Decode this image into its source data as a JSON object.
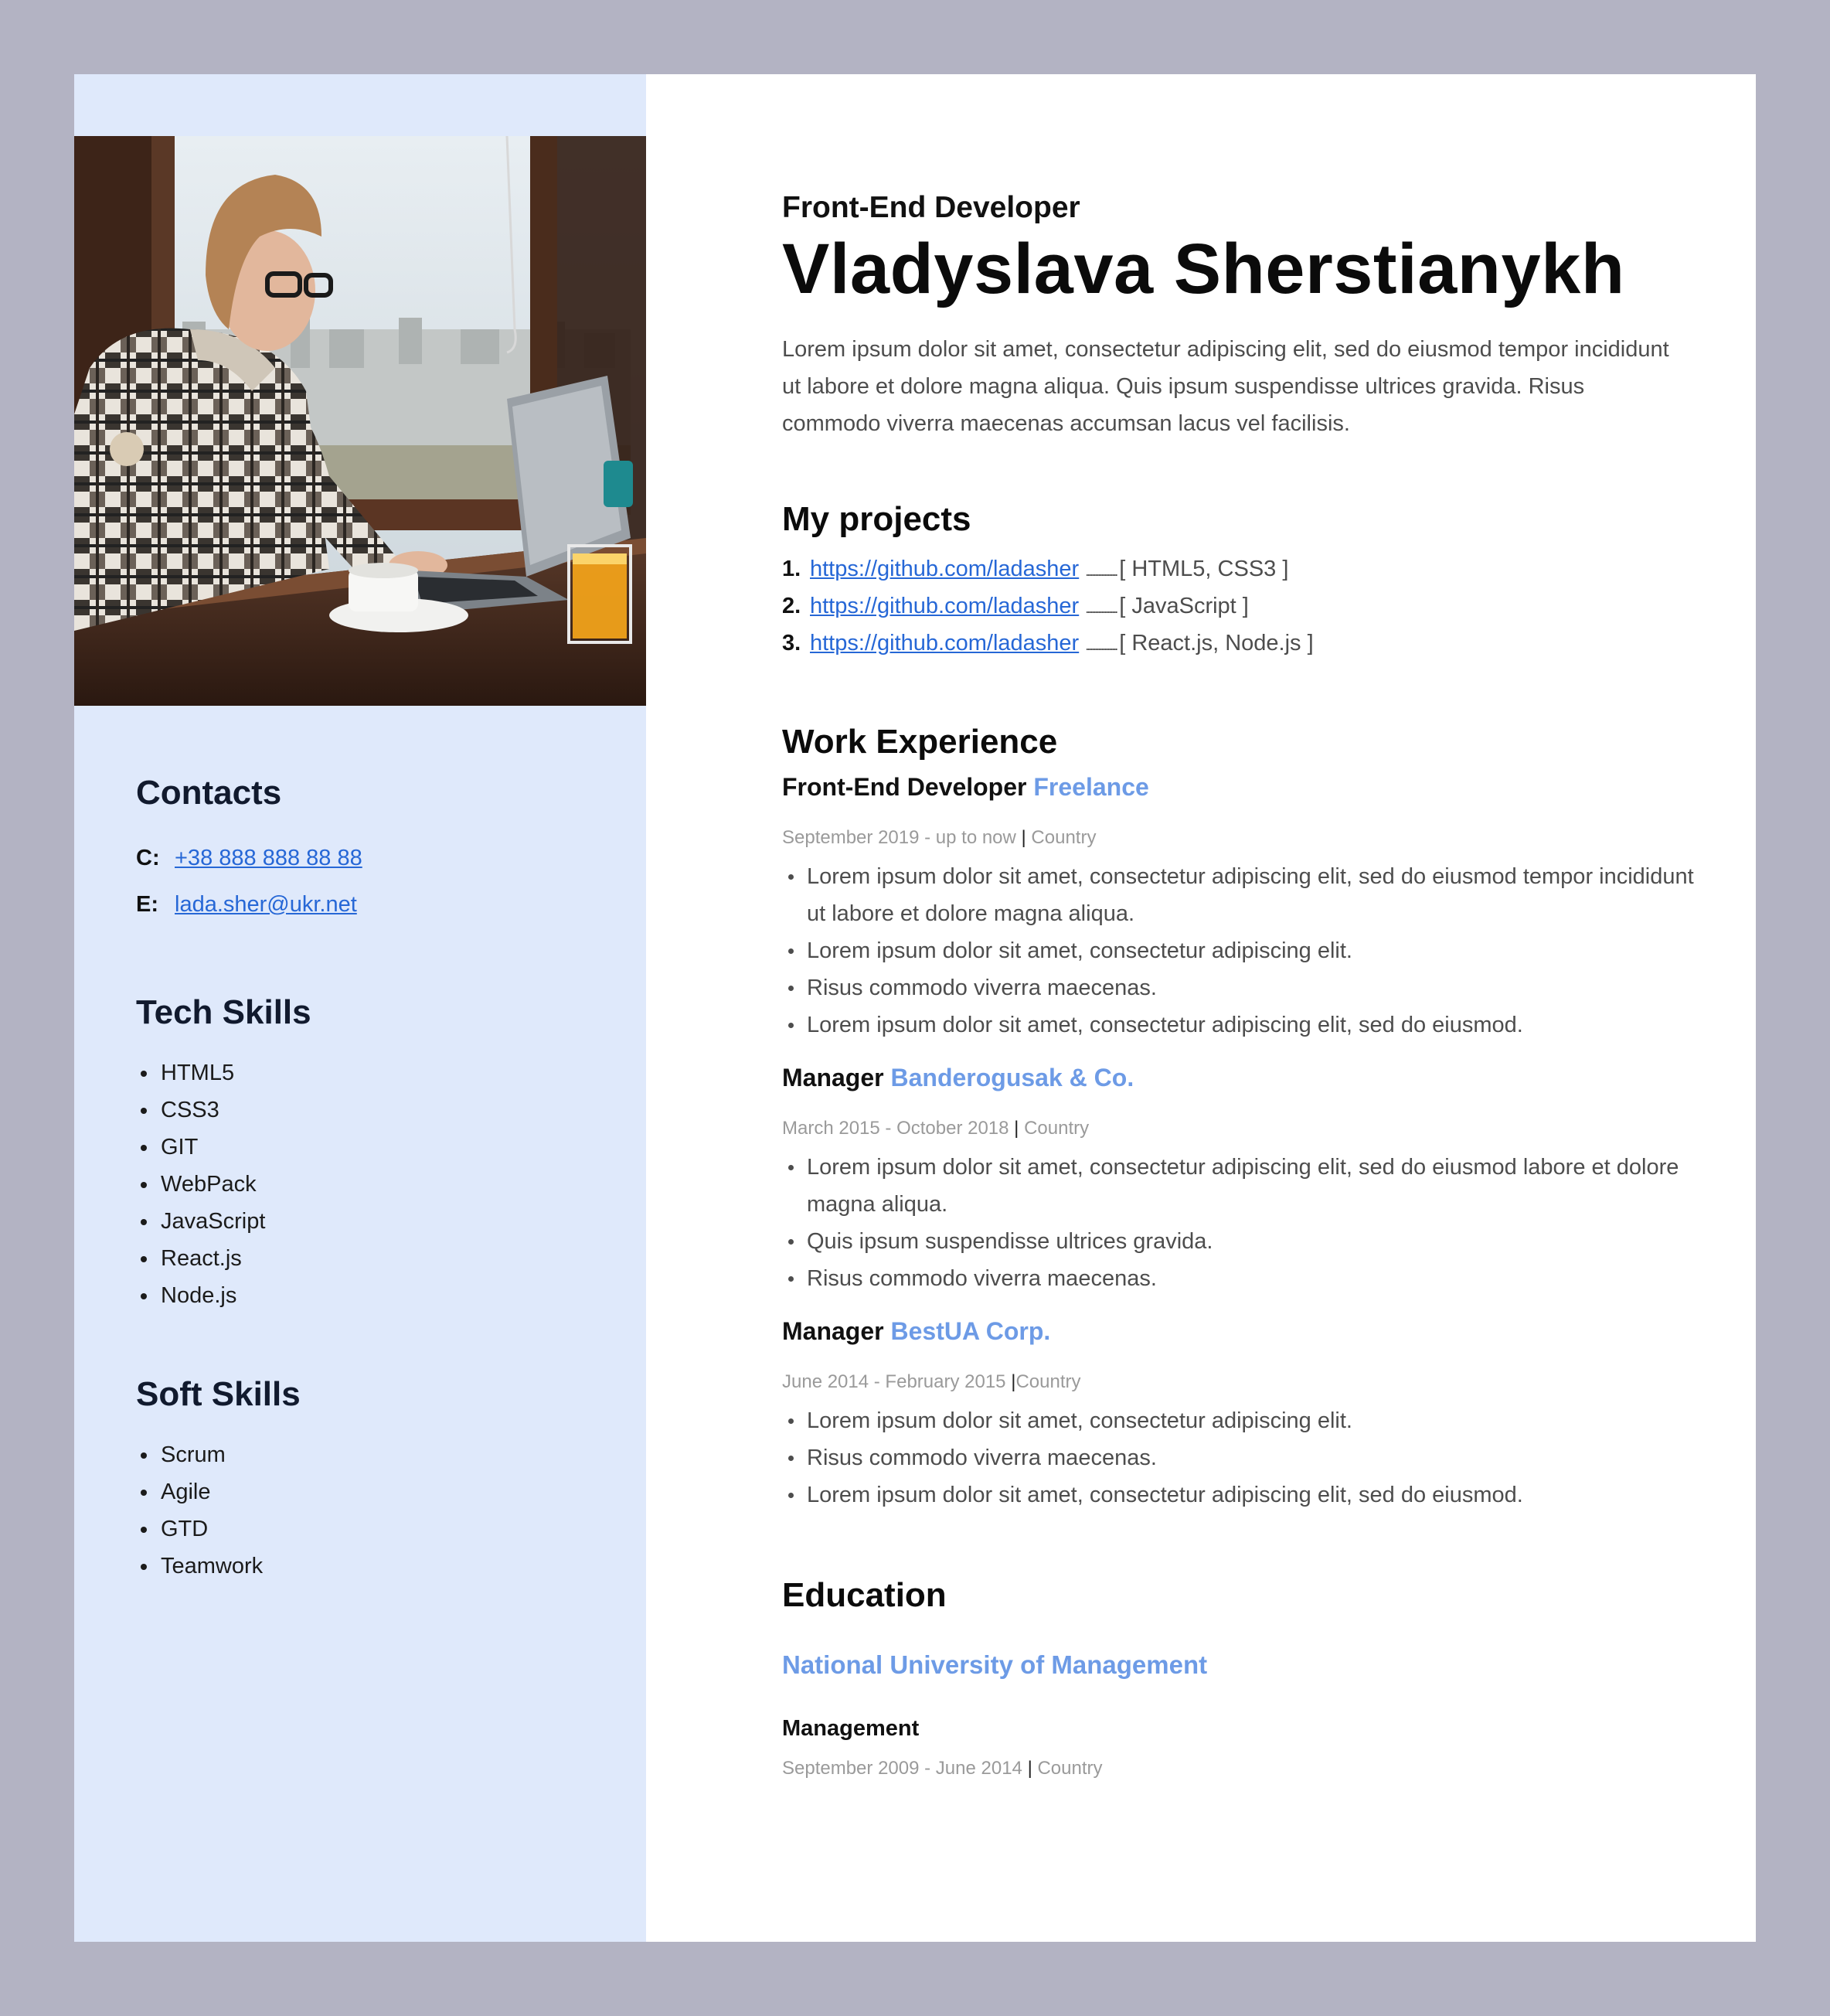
{
  "sidebar": {
    "photo_alt": "Woman in checkered shirt working on a laptop by a window",
    "contacts": {
      "heading": "Contacts",
      "phone_key": "C:",
      "phone": "+38 888 888 88 88",
      "email_key": "E:",
      "email": "lada.sher@ukr.net"
    },
    "tech_skills": {
      "heading": "Tech Skills",
      "items": [
        "HTML5",
        "CSS3",
        "GIT",
        "WebPack",
        "JavaScript",
        "React.js",
        "Node.js"
      ]
    },
    "soft_skills": {
      "heading": "Soft Skills",
      "items": [
        "Scrum",
        "Agile",
        "GTD",
        "Teamwork"
      ]
    }
  },
  "header": {
    "role": "Front-End Developer",
    "name": "Vladyslava Sherstianykh",
    "intro": "Lorem ipsum dolor sit amet, consectetur adipiscing elit, sed do eiusmod tempor incididunt ut labore et dolore magna aliqua. Quis ipsum suspendisse ultrices gravida. Risus commodo viverra maecenas accumsan lacus vel facilisis."
  },
  "projects": {
    "heading": "My projects",
    "items": [
      {
        "num": "1.",
        "url": "https://github.com/ladasher",
        "dots": "....................",
        "stack": "[ HTML5, CSS3 ]"
      },
      {
        "num": "2.",
        "url": "https://github.com/ladasher",
        "dots": "....................",
        "stack": "[ JavaScript ]"
      },
      {
        "num": "3.",
        "url": "https://github.com/ladasher",
        "dots": "....................",
        "stack": "[ React.js, Node.js ]"
      }
    ]
  },
  "work": {
    "heading": "Work Experience",
    "jobs": [
      {
        "title": "Front-End Developer",
        "company": "Freelance",
        "dates": "September 2019 - up to now ",
        "sep": "|",
        "location": " Country",
        "bullets": [
          "Lorem ipsum dolor sit amet, consectetur adipiscing elit, sed do eiusmod tempor incididunt ut labore et dolore magna aliqua.",
          "Lorem ipsum dolor sit amet, consectetur adipiscing elit.",
          "Risus commodo viverra maecenas.",
          "Lorem ipsum dolor sit amet, consectetur adipiscing elit, sed do eiusmod."
        ]
      },
      {
        "title": "Manager",
        "company": "Banderogusak & Co.",
        "dates": "March 2015 - October 2018 ",
        "sep": "|",
        "location": " Country",
        "bullets": [
          "Lorem ipsum dolor sit amet, consectetur adipiscing elit, sed do eiusmod labore et dolore magna aliqua.",
          "Quis ipsum suspendisse ultrices gravida.",
          "Risus commodo viverra maecenas."
        ]
      },
      {
        "title": "Manager",
        "company": "BestUA Corp.",
        "dates": "June 2014 - February 2015 ",
        "sep": "|",
        "location": "Country",
        "bullets": [
          "Lorem ipsum dolor sit amet, consectetur adipiscing elit.",
          "Risus commodo viverra maecenas.",
          "Lorem ipsum dolor sit amet, consectetur adipiscing elit, sed do eiusmod."
        ]
      }
    ]
  },
  "education": {
    "heading": "Education",
    "university": "National University of Management",
    "degree": "Management",
    "dates": "September 2009 - June 2014 ",
    "sep": "|",
    "location": " Country"
  },
  "colors": {
    "background": "#b3b3c3",
    "sidebar": "#dfe9fb",
    "accent": "#6d9be6",
    "link": "#2667d6"
  }
}
